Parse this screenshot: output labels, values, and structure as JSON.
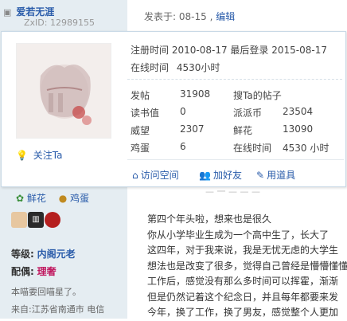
{
  "user": {
    "name": "爱若无涯",
    "uid_label": "ZxID: 12989155"
  },
  "post_meta": {
    "posted": "发表于: 08-15",
    "edit": "编辑"
  },
  "card": {
    "register_label": "注册时间",
    "register_date": "2010-08-17",
    "last_login_label": "最后登录",
    "last_login_date": "2015-08-17",
    "online_label": "在线时间",
    "online_value": "4530小时",
    "follow": "关注Ta",
    "stats": [
      {
        "label": "发帖",
        "value": "31908"
      },
      {
        "label": "读书值",
        "value": "0"
      },
      {
        "label": "威望",
        "value": "2307"
      },
      {
        "label": "鸡蛋",
        "value": "6"
      }
    ],
    "stats_right": [
      {
        "label": "搜Ta的帖子",
        "value": ""
      },
      {
        "label": "派派币",
        "value": "23504"
      },
      {
        "label": "鲜花",
        "value": "13090"
      },
      {
        "label": "在线时间",
        "value": "4530 小时"
      }
    ],
    "actions": [
      {
        "label": "访问空间",
        "icon": "home-icon"
      },
      {
        "label": "加好友",
        "icon": "add-friend-icon"
      },
      {
        "label": "用道具",
        "icon": "tool-icon"
      }
    ]
  },
  "sidebar": {
    "flower": "鲜花",
    "egg": "鸡蛋",
    "level_label": "等级:",
    "level_value": "内阁元老",
    "spouse_label": "配偶:",
    "spouse_value": "理奢",
    "signature": "本喵要回喵星了。",
    "location": "来自:江苏省南通市 电信"
  },
  "post": {
    "lines": [
      "第四个年头啦，想来也是很久",
      "你从小学毕业生成为一个高中生了，长大了",
      "这四年，对于我来说，我是无忧无虑的大学生",
      "想法也是改变了很多，觉得自己曾经是懵懵懂懂",
      "工作后，感觉没有那么多时间可以挥霍，渐渐",
      "但是仍然记着这个纪念日，并且每年都要来发",
      "今年，换了工作，换了男友，感觉整个人更加"
    ]
  }
}
